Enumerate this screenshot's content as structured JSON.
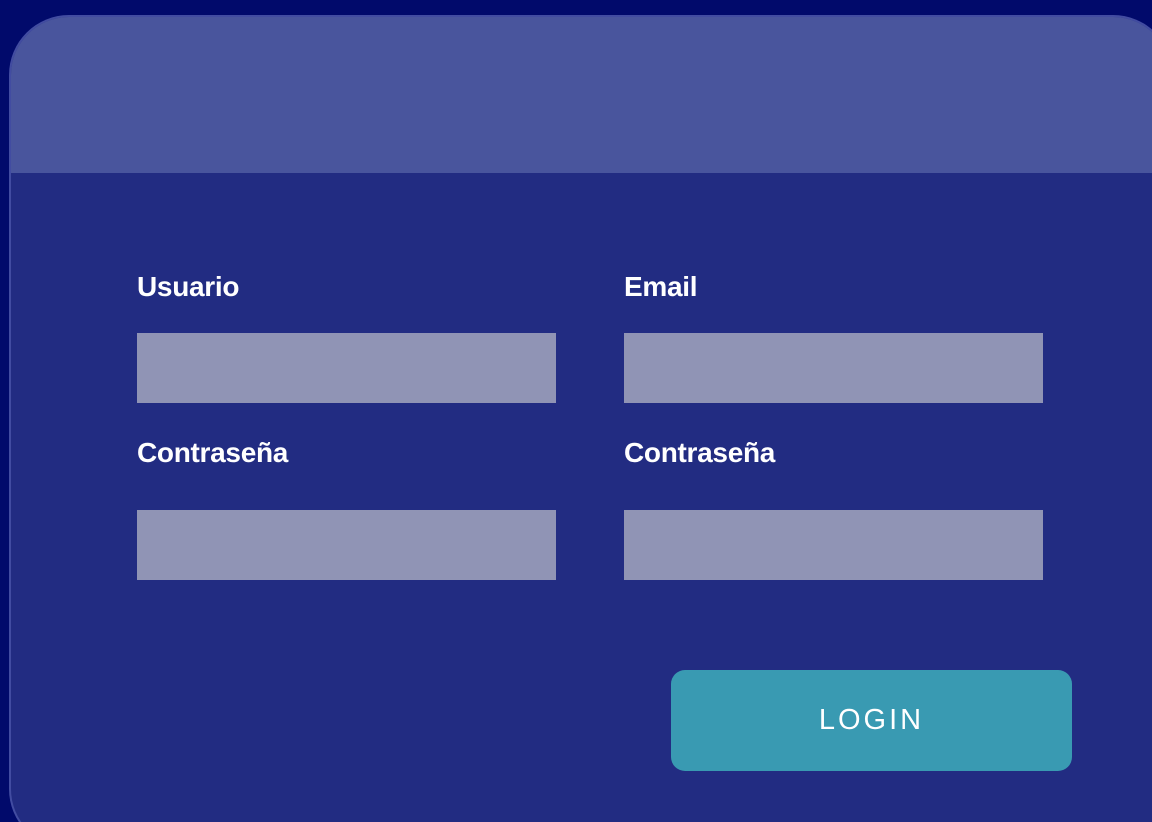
{
  "colors": {
    "page_background": "#010a6b",
    "card_background": "#222c82",
    "card_header": "#49559d",
    "input_background": "#9094b5",
    "button_background": "#399ab2",
    "text": "#ffffff"
  },
  "form": {
    "username": {
      "label": "Usuario",
      "value": "",
      "placeholder": ""
    },
    "email": {
      "label": "Email",
      "value": "",
      "placeholder": ""
    },
    "password": {
      "label": "Contraseña",
      "value": "",
      "placeholder": ""
    },
    "password_confirm": {
      "label": "Contraseña",
      "value": "",
      "placeholder": ""
    }
  },
  "login_button": {
    "label": "LOGIN"
  }
}
